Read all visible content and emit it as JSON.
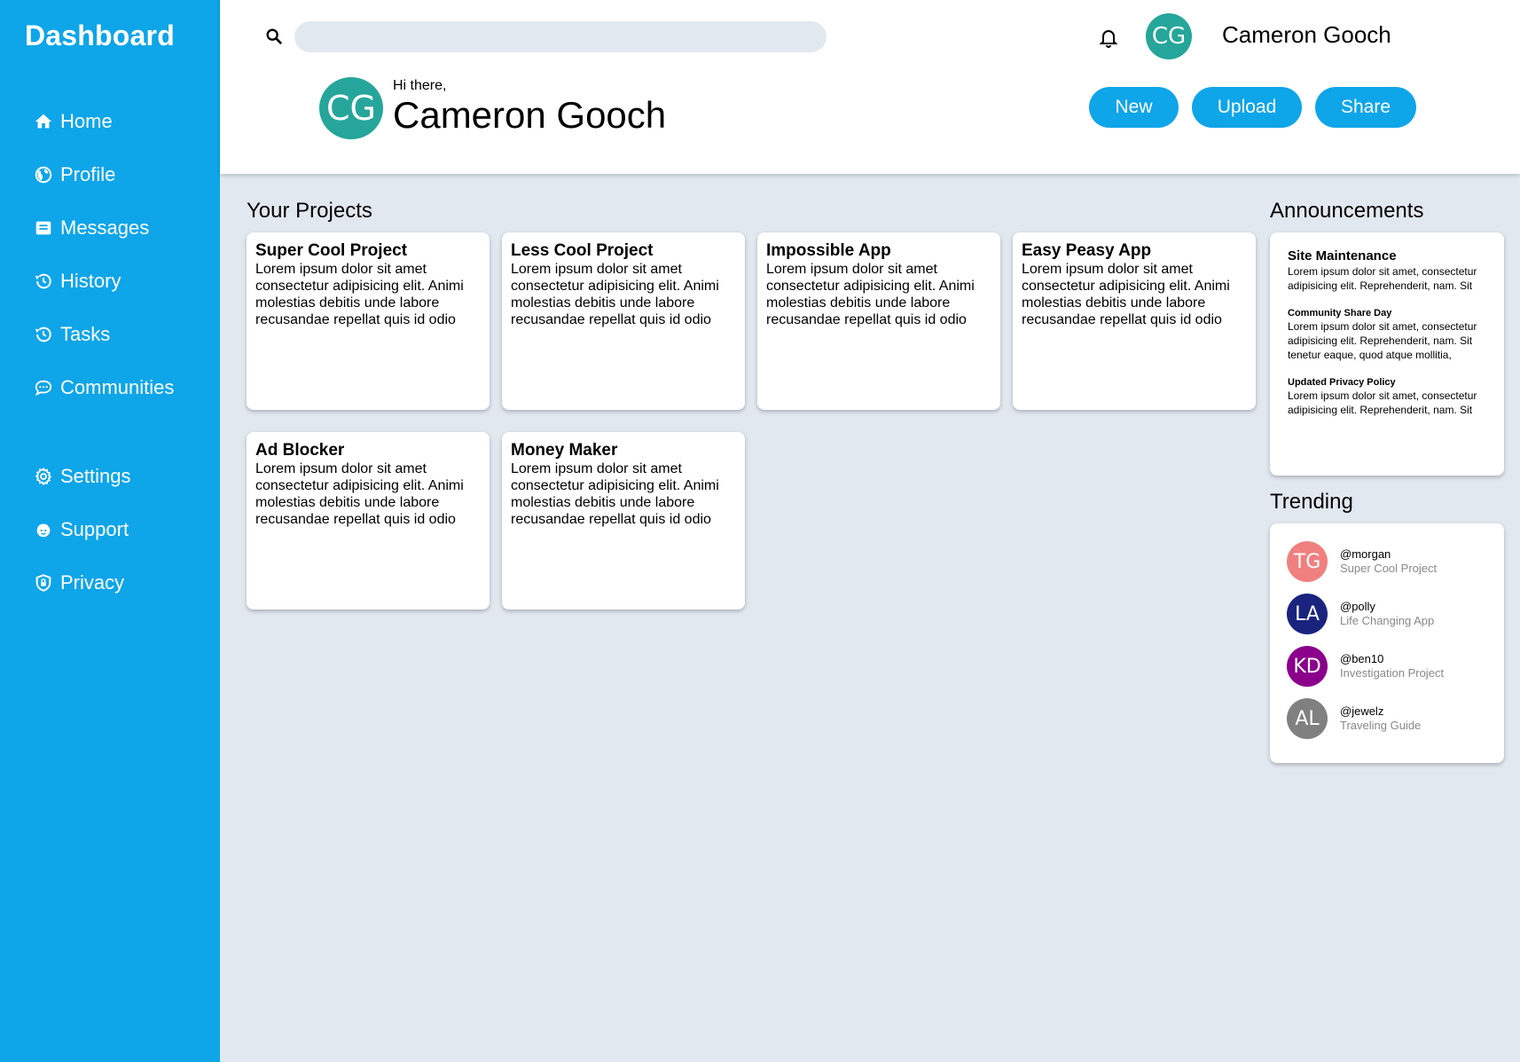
{
  "sidebar": {
    "brand": "Dashboard",
    "nav": [
      {
        "label": "Home",
        "icon": "home-icon"
      },
      {
        "label": "Profile",
        "icon": "globe-icon"
      },
      {
        "label": "Messages",
        "icon": "inbox-icon"
      },
      {
        "label": "History",
        "icon": "history-icon"
      },
      {
        "label": "Tasks",
        "icon": "history-icon"
      },
      {
        "label": "Communities",
        "icon": "chat-icon"
      }
    ],
    "nav_secondary": [
      {
        "label": "Settings",
        "icon": "gear-icon"
      },
      {
        "label": "Support",
        "icon": "support-icon"
      },
      {
        "label": "Privacy",
        "icon": "shield-icon"
      }
    ]
  },
  "header": {
    "search_placeholder": "",
    "user_initials": "CG",
    "user_name": "Cameron Gooch",
    "greeting": "Hi there,",
    "hero_name": "Cameron Gooch",
    "buttons": {
      "new": "New",
      "upload": "Upload",
      "share": "Share"
    }
  },
  "projects": {
    "title": "Your Projects",
    "items": [
      {
        "title": "Super Cool Project",
        "body": "Lorem ipsum dolor sit amet consectetur adipisicing elit. Animi molestias debitis unde labore recusandae repellat quis id odio"
      },
      {
        "title": "Less Cool Project",
        "body": "Lorem ipsum dolor sit amet consectetur adipisicing elit. Animi molestias debitis unde labore recusandae repellat quis id odio"
      },
      {
        "title": "Impossible App",
        "body": "Lorem ipsum dolor sit amet consectetur adipisicing elit. Animi molestias debitis unde labore recusandae repellat quis id odio"
      },
      {
        "title": "Easy Peasy App",
        "body": "Lorem ipsum dolor sit amet consectetur adipisicing elit. Animi molestias debitis unde labore recusandae repellat quis id odio"
      },
      {
        "title": "Ad Blocker",
        "body": "Lorem ipsum dolor sit amet consectetur adipisicing elit. Animi molestias debitis unde labore recusandae repellat quis id odio"
      },
      {
        "title": "Money Maker",
        "body": "Lorem ipsum dolor sit amet consectetur adipisicing elit. Animi molestias debitis unde labore recusandae repellat quis id odio"
      }
    ]
  },
  "announcements": {
    "title": "Announcements",
    "items": [
      {
        "title": "Site Maintenance",
        "body": "Lorem ipsum dolor sit amet, consectetur adipisicing elit. Reprehenderit, nam. Sit"
      },
      {
        "title": "Community Share Day",
        "body": "Lorem ipsum dolor sit amet, consectetur adipisicing elit. Reprehenderit, nam. Sit tenetur eaque, quod atque mollitia,"
      },
      {
        "title": "Updated Privacy Policy",
        "body": "Lorem ipsum dolor sit amet, consectetur adipisicing elit. Reprehenderit, nam. Sit"
      }
    ]
  },
  "trending": {
    "title": "Trending",
    "items": [
      {
        "initials": "TG",
        "handle": "@morgan",
        "project": "Super Cool Project",
        "color": "#f08080"
      },
      {
        "initials": "LA",
        "handle": "@polly",
        "project": "Life Changing App",
        "color": "#1a237e"
      },
      {
        "initials": "KD",
        "handle": "@ben10",
        "project": "Investigation Project",
        "color": "#8b008b"
      },
      {
        "initials": "AL",
        "handle": "@jewelz",
        "project": "Traveling Guide",
        "color": "#808080"
      }
    ]
  },
  "colors": {
    "accent": "#0ea5e9",
    "background": "#e2e8f0",
    "avatar": "#26a69a"
  }
}
